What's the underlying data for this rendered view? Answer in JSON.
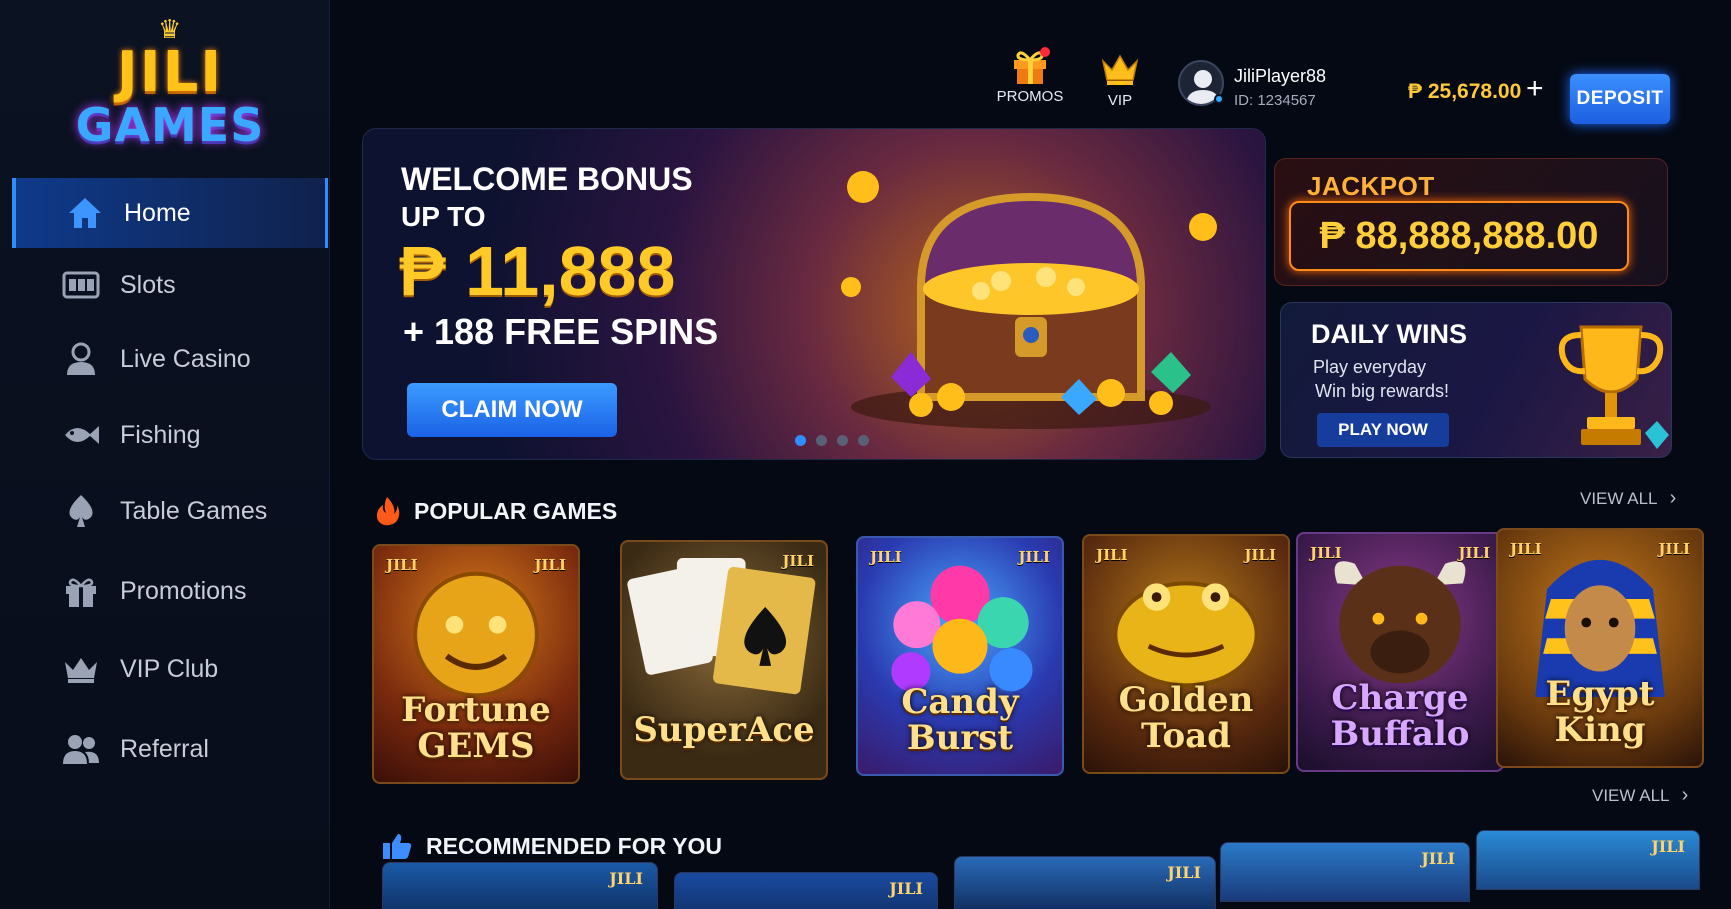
{
  "brand": {
    "line1": "JILI",
    "line2": "GAMES"
  },
  "sidebar": {
    "items": [
      {
        "label": "Home",
        "icon": "home-icon"
      },
      {
        "label": "Slots",
        "icon": "slot-machine-icon"
      },
      {
        "label": "Live Casino",
        "icon": "person-icon"
      },
      {
        "label": "Fishing",
        "icon": "fish-icon"
      },
      {
        "label": "Table Games",
        "icon": "spade-icon"
      },
      {
        "label": "Promotions",
        "icon": "gift-icon"
      },
      {
        "label": "VIP Club",
        "icon": "crown-icon"
      },
      {
        "label": "Referral",
        "icon": "users-icon"
      }
    ]
  },
  "header": {
    "promos_label": "PROMOS",
    "vip_label": "VIP",
    "username": "JiliPlayer88",
    "user_id": "ID: 1234567",
    "balance": "₱ 25,678.00",
    "plus_label": "+",
    "deposit_label": "DEPOSIT"
  },
  "hero": {
    "title": "WELCOME BONUS",
    "subtitle": "UP TO",
    "amount": "₱ 11,888",
    "extra": "+ 188 FREE SPINS",
    "cta": "CLAIM NOW",
    "slide_count": 4,
    "active_slide": 1
  },
  "jackpot": {
    "label": "JACKPOT",
    "amount": "₱ 88,888,888.00"
  },
  "daily": {
    "title": "DAILY WINS",
    "line1": "Play everyday",
    "line2": "Win big rewards!",
    "cta": "PLAY NOW"
  },
  "popular": {
    "title": "POPULAR GAMES",
    "view_all": "VIEW ALL",
    "games": [
      {
        "name_line1": "Fortune",
        "name_line2": "GEMS",
        "provider": "JILI"
      },
      {
        "name_line1": "SuperAce",
        "name_line2": "",
        "provider": "JILI"
      },
      {
        "name_line1": "Candy",
        "name_line2": "Burst",
        "provider": "JILI"
      },
      {
        "name_line1": "Golden",
        "name_line2": "Toad",
        "provider": "JILI"
      },
      {
        "name_line1": "Charge",
        "name_line2": "Buffalo",
        "provider": "JILI"
      },
      {
        "name_line1": "Egypt",
        "name_line2": "King",
        "provider": "JILI"
      }
    ]
  },
  "recommended": {
    "title": "RECOMMENDED FOR YOU",
    "view_all": "VIEW ALL",
    "provider": "JILI"
  },
  "colors": {
    "accent": "#2f8dff",
    "gold": "#ffc928",
    "background": "#050914"
  }
}
